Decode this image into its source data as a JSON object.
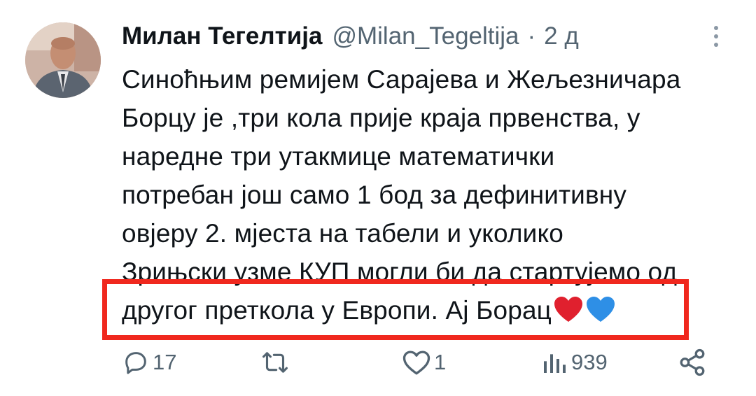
{
  "tweet": {
    "author_name": "Милан Тегелтија",
    "handle": "@Milan_Tegeltija",
    "separator": "·",
    "time": "2 д",
    "text_lines": [
      "Синоћњим ремијем Сарајева и Жељезничара",
      "Борцу је ,три кола прије краја првенства, у",
      "наредне три утакмице математички",
      "потребан још само 1 бод за дефинитивну",
      "овјеру 2. мјеста на табели и уколико",
      "Зрињски узме КУП могли би да стартујемо од",
      "другог преткола у Европи. Ај Борац"
    ],
    "emoji": [
      "red-heart",
      "blue-heart"
    ]
  },
  "actions": {
    "replies": "17",
    "retweets": "",
    "likes": "1",
    "views": "939"
  },
  "colors": {
    "text": "#0f1419",
    "muted": "#536471",
    "highlight_border": "#f0281e",
    "heart_red": "#e0202e",
    "heart_blue": "#2e8fe6"
  }
}
